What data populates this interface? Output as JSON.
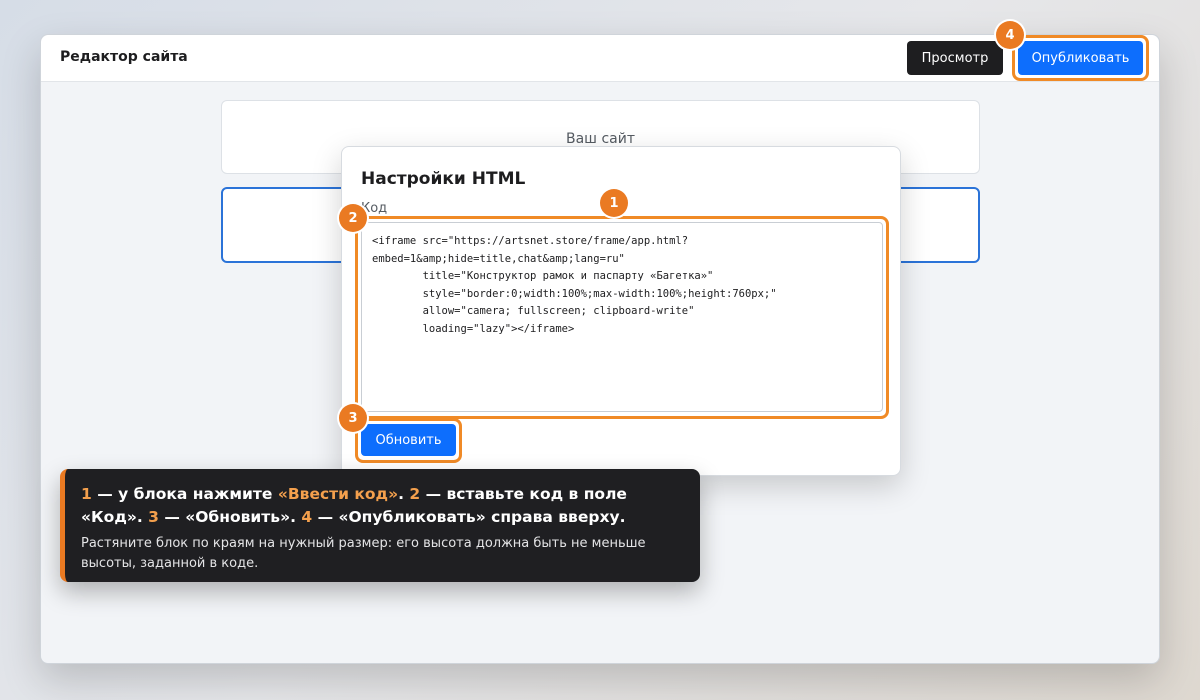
{
  "header": {
    "title": "Редактор сайта",
    "preview_label": "Просмотр",
    "publish_label": "Опубликовать"
  },
  "canvas": {
    "site_block_label": "Ваш сайт"
  },
  "dialog": {
    "title": "Настройки HTML",
    "code_label": "Код",
    "code_value": "<iframe src=\"https://artsnet.store/frame/app.html?\nembed=1&amp;hide=title,chat&amp;lang=ru\"\n        title=\"Конструктор рамок и паспарту «Багетка»\"\n        style=\"border:0;width:100%;max-width:100%;height:760px;\"\n        allow=\"camera; fullscreen; clipboard-write\"\n        loading=\"lazy\"></iframe>",
    "update_label": "Обновить"
  },
  "steps": {
    "s1": "1",
    "s2": "2",
    "s3": "3",
    "s4": "4"
  },
  "hint": {
    "n1": "1",
    "t1": " — у блока нажмите ",
    "h1": "«Ввести код»",
    "t2": ". ",
    "n2": "2",
    "t3": " — вставьте код в поле «Код». ",
    "n3": "3",
    "t4": " — «Обновить». ",
    "n4": "4",
    "t5": " — «Опубликовать» справа вверху.",
    "sub": "Растяните блок по краям на нужный размер: его высота должна быть не меньше высоты, заданной в коде."
  },
  "colors": {
    "accent": "#ea7a22",
    "primary": "#0d6efd",
    "dark": "#1e1e20"
  }
}
